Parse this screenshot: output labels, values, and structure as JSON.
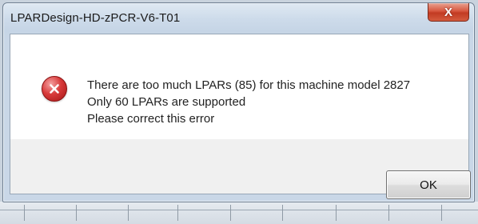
{
  "dialog": {
    "title": "LPARDesign-HD-zPCR-V6-T01",
    "close_glyph": "X",
    "icon": "error-icon",
    "message_lines": [
      "There are too much LPARs (85) for this machine model 2827",
      "Only 60 LPARs are supported",
      "Please correct this error"
    ],
    "ok_label": "OK"
  },
  "colors": {
    "error_red": "#d83a3a",
    "close_button_red": "#c23b22",
    "frame_blue": "#c6d5e6"
  }
}
